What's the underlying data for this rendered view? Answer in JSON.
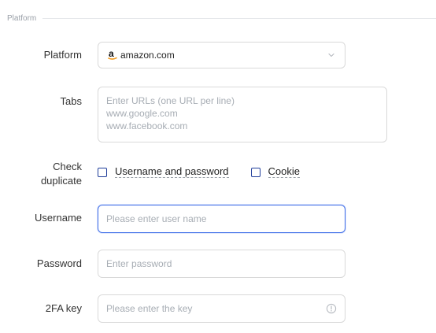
{
  "section": {
    "title": "Platform"
  },
  "platform": {
    "label": "Platform",
    "selected_value": "amazon.com",
    "icon": "amazon-icon"
  },
  "tabs": {
    "label": "Tabs",
    "placeholder_lines": [
      "Enter URLs (one URL per line)",
      "www.google.com",
      "www.facebook.com"
    ]
  },
  "check_duplicate": {
    "label_line1": "Check",
    "label_line2": "duplicate",
    "options": [
      {
        "label": "Username and password",
        "checked": false
      },
      {
        "label": "Cookie",
        "checked": false
      }
    ]
  },
  "username": {
    "label": "Username",
    "placeholder": "Please enter user name",
    "value": ""
  },
  "password": {
    "label": "Password",
    "placeholder": "Enter password",
    "value": ""
  },
  "twofa": {
    "label": "2FA key",
    "placeholder": "Please enter the key",
    "value": ""
  },
  "colors": {
    "accent": "#3f6ee8",
    "checkbox_border": "#1f3d9a",
    "placeholder": "#a7adb4",
    "border": "#d9d9d9"
  }
}
